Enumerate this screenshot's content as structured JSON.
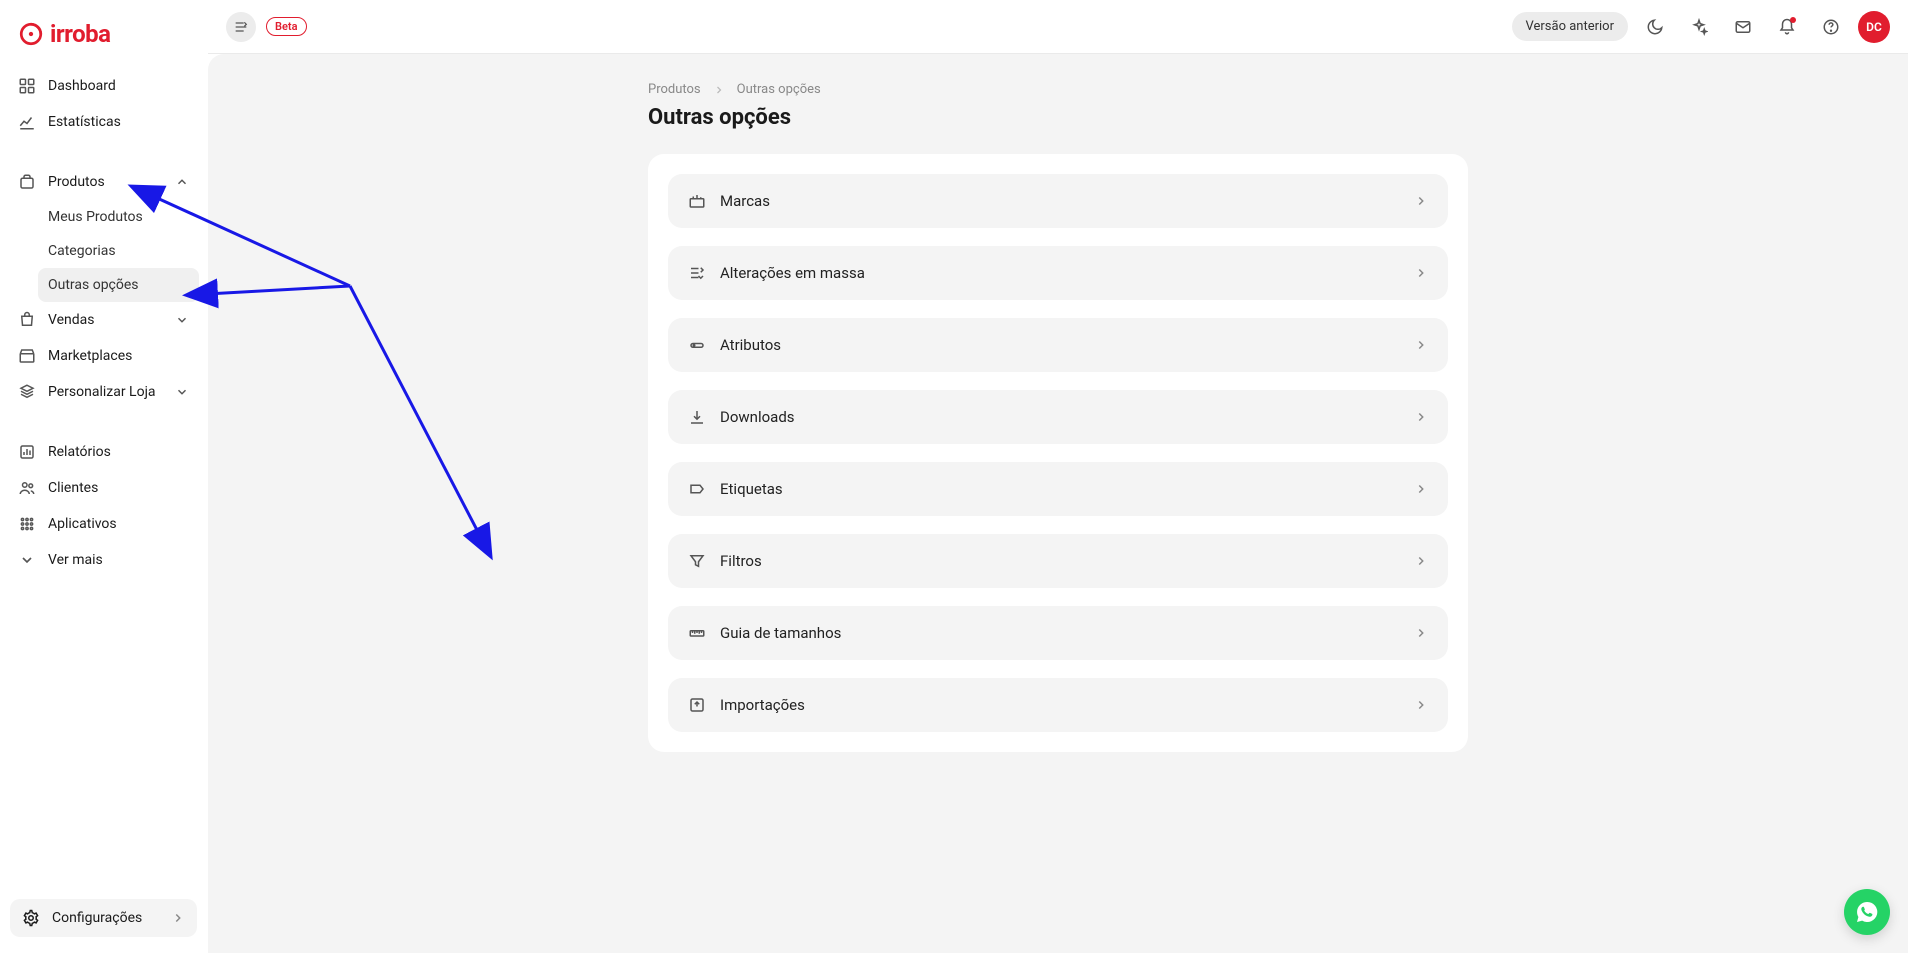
{
  "brand": {
    "name": "irroba"
  },
  "topbar": {
    "beta_label": "Beta",
    "version_label": "Versão anterior",
    "avatar_initials": "DC"
  },
  "sidebar": {
    "items": [
      {
        "label": "Dashboard",
        "icon": "dashboard"
      },
      {
        "label": "Estatísticas",
        "icon": "stats"
      }
    ],
    "items2": [
      {
        "label": "Produtos",
        "icon": "products",
        "expanded": true,
        "children": [
          {
            "label": "Meus Produtos"
          },
          {
            "label": "Categorias"
          },
          {
            "label": "Outras opções",
            "active": true
          }
        ]
      },
      {
        "label": "Vendas",
        "icon": "sales",
        "expandable": true
      },
      {
        "label": "Marketplaces",
        "icon": "market"
      },
      {
        "label": "Personalizar Loja",
        "icon": "customize",
        "expandable": true
      }
    ],
    "items3": [
      {
        "label": "Relatórios",
        "icon": "reports"
      },
      {
        "label": "Clientes",
        "icon": "clients"
      },
      {
        "label": "Aplicativos",
        "icon": "apps"
      },
      {
        "label": "Ver mais",
        "icon": "more"
      }
    ],
    "config_label": "Configurações"
  },
  "breadcrumb": {
    "items": [
      "Produtos",
      "Outras opções"
    ]
  },
  "page": {
    "title": "Outras opções"
  },
  "options": [
    {
      "label": "Marcas",
      "icon": "brands"
    },
    {
      "label": "Alterações em massa",
      "icon": "bulk"
    },
    {
      "label": "Atributos",
      "icon": "attributes"
    },
    {
      "label": "Downloads",
      "icon": "downloads"
    },
    {
      "label": "Etiquetas",
      "icon": "labels"
    },
    {
      "label": "Filtros",
      "icon": "filters"
    },
    {
      "label": "Guia de tamanhos",
      "icon": "sizeguide"
    },
    {
      "label": "Importações",
      "icon": "imports"
    }
  ]
}
